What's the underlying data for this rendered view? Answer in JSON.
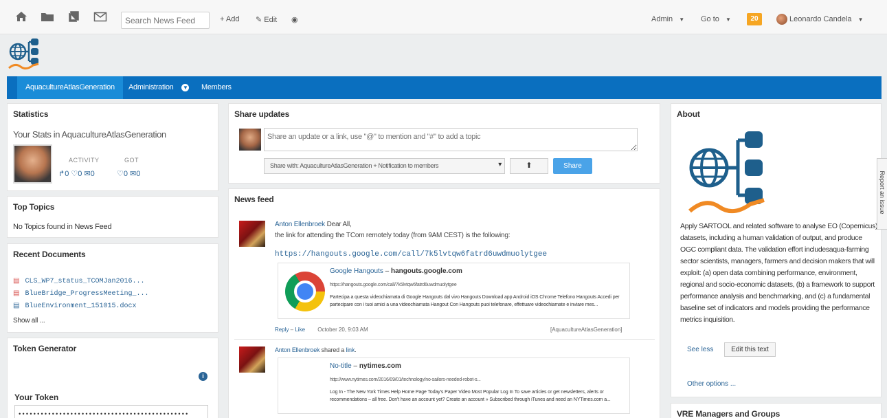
{
  "topbar": {
    "icons": [
      "home-icon",
      "folder-icon",
      "documents-icon",
      "mail-icon"
    ],
    "search_placeholder": "Search News Feed",
    "add_label": "+ Add",
    "edit_label": "Edit",
    "admin_label": "Admin",
    "goto_label": "Go to",
    "notifications_count": "20",
    "user_name": "Leonardo Candela",
    "badge_color": "#f6a623"
  },
  "nav": {
    "items": [
      {
        "label": "AquacultureAtlasGeneration",
        "active": true
      },
      {
        "label": "Administration"
      },
      {
        "label": "Members"
      }
    ],
    "bar_color": "#0a6fbf"
  },
  "statistics": {
    "title": "Statistics",
    "subtitle": "Your Stats in AquacultureAtlasGeneration",
    "activity_label": "ACTIVITY",
    "got_label": "GOT",
    "activity_values": "↱0 ♡0 ✉0",
    "got_values": "♡0 ✉0"
  },
  "top_topics": {
    "title": "Top Topics",
    "empty_text": "No Topics found in News Feed"
  },
  "recent_documents": {
    "title": "Recent Documents",
    "docs": [
      "CLS_WP7_status_TCOMJan2016...",
      "BlueBridge_ProgressMeeting_...",
      "BlueEnvironment_151015.docx"
    ],
    "show_all": "Show all ..."
  },
  "token_generator": {
    "title": "Token Generator",
    "your_token_label": "Your Token",
    "token_value": "••••••••••••••••••••••••••••••••••••••••••••••"
  },
  "share": {
    "title": "Share updates",
    "input_placeholder": "Share an update or a link, use \"@\" to mention and \"#\" to add a topic",
    "share_with": "Share with: AquacultureAtlasGeneration + Notification to members",
    "share_button": "Share"
  },
  "news_feed": {
    "title": "News feed",
    "posts": [
      {
        "author": "Anton Ellenbroek",
        "text1": "Dear All,",
        "text2": "the link for attending the TCom remotely today (from 9AM CEST) is the following:",
        "link": "https://hangouts.google.com/call/7k5lvtqw6fatrd6uwdmuolytgee",
        "preview_title_1": "Google Hangouts",
        "preview_title_2": "hangouts.google.com",
        "preview_url": "https://hangouts.google.com/call/7k5lvtqw6fatrd6uwdmuolytgee",
        "preview_desc": "Partecipa a questa videochiamata di Google Hangouts dal vivo Hangouts Download app Android iOS Chrome Telefono Hangouts Accedi per partecipare con i tuoi amici a una videochiamata Hangout Con Hangouts puoi telefonare, effettuare videochiamate e inviare mes...",
        "reply": "Reply",
        "like": "Like",
        "date": "October 20, 9:03 AM",
        "group": "[AquacultureAtlasGeneration]"
      },
      {
        "author": "Anton Ellenbroek",
        "shared": "shared a",
        "shared_link": "link",
        "preview_title_1": "No-title",
        "preview_title_2": "nytimes.com",
        "preview_url": "http://www.nytimes.com/2016/09/01/technology/no-sailors-needed-robot-s...",
        "preview_desc": "Log In - The New York Times Help Home Page Today's Paper Video Most Popular Log In To save articles or get newsletters, alerts or recommendations – all free. Don't have an account yet? Create an account » Subscribed through iTunes and need an NYTimes.com a..."
      }
    ]
  },
  "about": {
    "title": "About",
    "text": "Apply SARTOOL and related software to analyse EO (Copernicus) datasets, including a human validation of output, and produce OGC compliant data. The validation effort includesaqua-farming sector scientists, managers, farmers and decision makers that will exploit: (a) open data combining performance, environment, regional and socio-economic datasets, (b) a framework to support performance analysis and benchmarking, and (c) a fundamental baseline set of indicators and models providing the performance metrics inquisition.",
    "see_less": "See less",
    "edit_text": "Edit this text",
    "other_options": "Other options ..."
  },
  "vre_managers": {
    "title": "VRE Managers and Groups"
  },
  "report_issue": "Report an issue"
}
